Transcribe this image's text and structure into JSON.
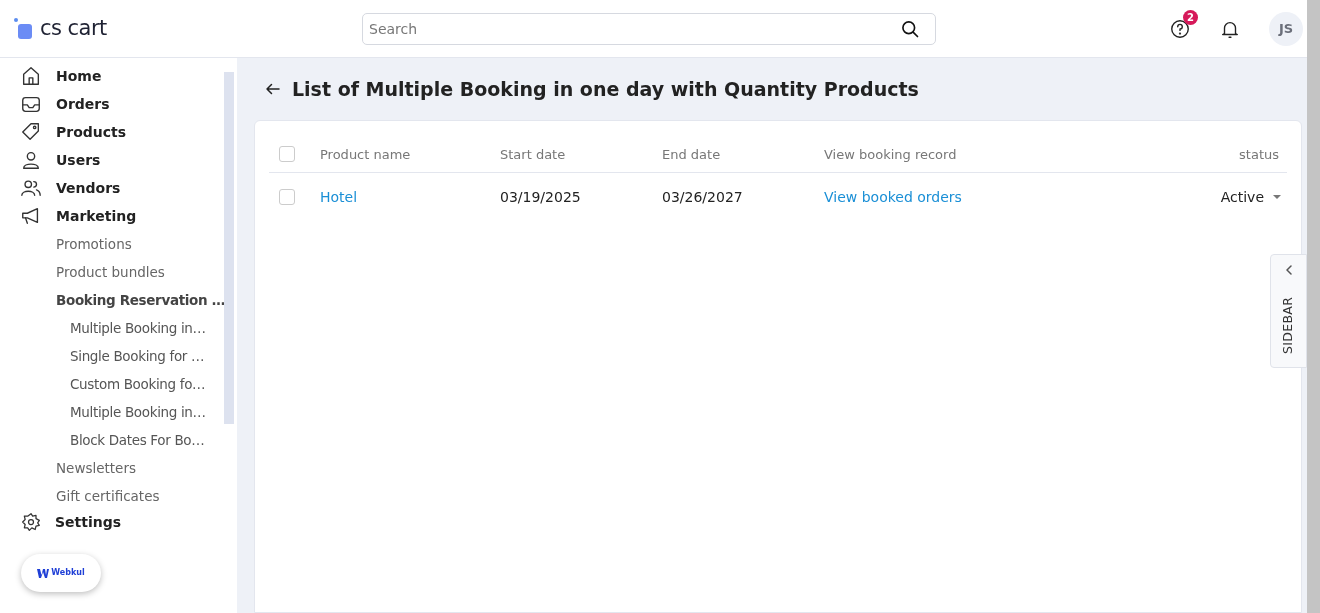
{
  "logo": {
    "text": "cs cart"
  },
  "search": {
    "placeholder": "Search"
  },
  "header": {
    "help_badge": "2",
    "avatar": "JS"
  },
  "sidebar": {
    "items": [
      {
        "label": "Home"
      },
      {
        "label": "Orders"
      },
      {
        "label": "Products"
      },
      {
        "label": "Users"
      },
      {
        "label": "Vendors"
      },
      {
        "label": "Marketing",
        "children": [
          {
            "label": "Promotions",
            "selected": false
          },
          {
            "label": "Product bundles",
            "selected": false
          },
          {
            "label": "Booking Reservation …",
            "selected": true,
            "children": [
              {
                "label": "Multiple Booking in…"
              },
              {
                "label": "Single Booking for …"
              },
              {
                "label": "Custom Booking fo…"
              },
              {
                "label": "Multiple Booking in…"
              },
              {
                "label": "Block Dates For Bo…"
              }
            ]
          },
          {
            "label": "Newsletters",
            "selected": false
          },
          {
            "label": "Gift certificates",
            "selected": false
          }
        ]
      }
    ],
    "settings": {
      "label": "Settings"
    },
    "badge": "Webkul"
  },
  "page": {
    "title": "List of Multiple Booking in one day with Quantity Products"
  },
  "table": {
    "select_all": {
      "checked": false
    },
    "columns": [
      "Product name",
      "Start date",
      "End date",
      "View booking record",
      "status"
    ],
    "rows": [
      {
        "checked": false,
        "product": "Hotel",
        "start": "03/19/2025",
        "end": "03/26/2027",
        "record": "View booked orders",
        "status": "Active"
      }
    ]
  },
  "side_tab": {
    "label": "SIDEBAR"
  }
}
